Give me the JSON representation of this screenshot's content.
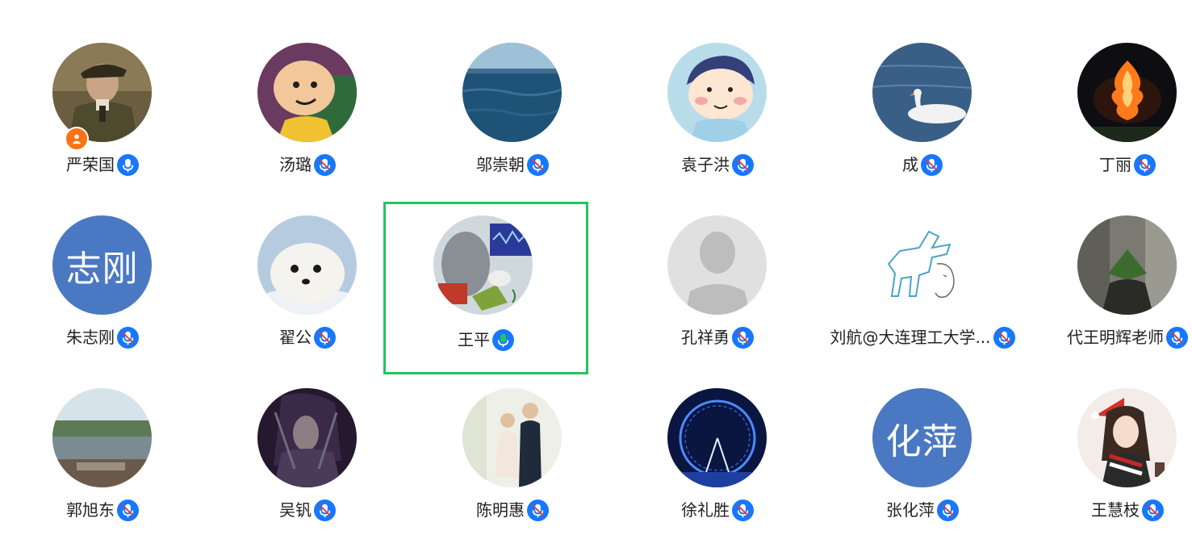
{
  "participants": [
    {
      "name": "严荣国",
      "mic": "active",
      "avatar": "soldier-photo",
      "host": true
    },
    {
      "name": "汤璐",
      "mic": "muted",
      "avatar": "cartoon-boy"
    },
    {
      "name": "邬崇朝",
      "mic": "muted",
      "avatar": "ocean-photo"
    },
    {
      "name": "袁子洪",
      "mic": "muted",
      "avatar": "cartoon-kid"
    },
    {
      "name": "成",
      "mic": "muted",
      "avatar": "swan-photo"
    },
    {
      "name": "丁丽",
      "mic": "muted",
      "avatar": "night-sculpture-photo"
    },
    {
      "name": "朱志刚",
      "mic": "muted",
      "avatar": "text",
      "avatar_text": "志刚",
      "avatar_color": "#4a78c2"
    },
    {
      "name": "翟公",
      "mic": "muted",
      "avatar": "seal-photo"
    },
    {
      "name": "王平",
      "mic": "speaking",
      "avatar": "science-collage",
      "selected": true
    },
    {
      "name": "孔祥勇",
      "mic": "muted",
      "avatar": "default-person"
    },
    {
      "name": "刘航@大连理工大学...",
      "mic": "muted",
      "avatar": "dinosaur-sketch"
    },
    {
      "name": "代王明辉老师",
      "mic": "muted",
      "avatar": "plant-person-photo"
    },
    {
      "name": "郭旭东",
      "mic": "muted",
      "avatar": "lake-photo"
    },
    {
      "name": "吴钒",
      "mic": "muted",
      "avatar": "dark-warrior"
    },
    {
      "name": "陈明惠",
      "mic": "muted",
      "avatar": "children-photo"
    },
    {
      "name": "徐礼胜",
      "mic": "muted",
      "avatar": "ferris-wheel-photo"
    },
    {
      "name": "张化萍",
      "mic": "muted",
      "avatar": "text",
      "avatar_text": "化萍",
      "avatar_color": "#4a78c2"
    },
    {
      "name": "王慧枝",
      "mic": "muted",
      "avatar": "christmas-girl"
    }
  ],
  "colors": {
    "mic_blue": "#1677ff",
    "mic_speaking_green": "#22c55e",
    "selected_border": "#22c55e",
    "host_badge": "#f97316"
  }
}
